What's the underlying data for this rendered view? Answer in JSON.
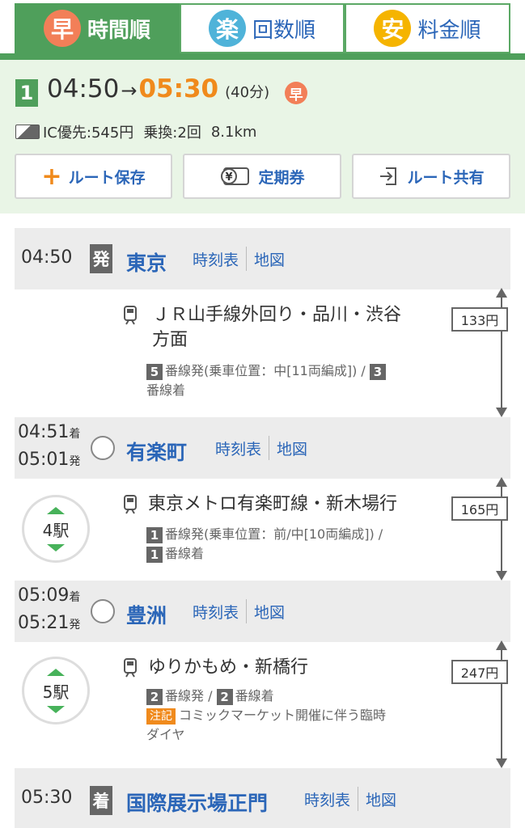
{
  "tabs": [
    {
      "badge": "早",
      "label": "時間順",
      "color": "#f27f58",
      "active": true
    },
    {
      "badge": "楽",
      "label": "回数順",
      "color": "#4fb3d9",
      "active": false
    },
    {
      "badge": "安",
      "label": "料金順",
      "color": "#f5b400",
      "active": false
    }
  ],
  "summary": {
    "route_no": "1",
    "depart": "04:50",
    "arrow": "→",
    "arrive": "05:30",
    "duration": "(40分)",
    "fast_badge": "早",
    "ic_fare": "IC優先:545円",
    "transfers": "乗換:2回",
    "distance": "8.1km",
    "buttons": {
      "save": "ルート保存",
      "pass": "定期券",
      "share": "ルート共有",
      "yen": "¥"
    }
  },
  "links": {
    "timetable": "時刻表",
    "map": "地図"
  },
  "stations": [
    {
      "name": "東京",
      "time1": "04:50",
      "badge": "発"
    },
    {
      "name": "有楽町",
      "time1": "04:51",
      "suffix1": "着",
      "time2": "05:01",
      "suffix2": "発"
    },
    {
      "name": "豊洲",
      "time1": "05:09",
      "suffix1": "着",
      "time2": "05:21",
      "suffix2": "発"
    },
    {
      "name": "国際展示場正門",
      "time1": "05:30",
      "badge": "着"
    }
  ],
  "segments": [
    {
      "line1": "ＪＲ山手線外回り・品川・渋谷",
      "line2": "方面",
      "plat_a_num": "5",
      "plat_a": "番線発(乗車位置：中[11両編成]) / ",
      "plat_b_num": "3",
      "plat_b": "番線着",
      "fare": "133円",
      "color": "#3fdc3a"
    },
    {
      "line1": "東京メトロ有楽町線・新木場行",
      "plat_a_num": "1",
      "plat_a": "番線発(乗車位置：前/中[10両編成]) /",
      "plat_b_num": "1",
      "plat_b": "番線着",
      "fare": "165円",
      "stops": "4駅",
      "color": "#c1a470"
    },
    {
      "line1": "ゆりかもめ・新橋行",
      "plat_a_num": "2",
      "plat_a": "番線発 / ",
      "plat_b_num": "2",
      "plat_b": "番線着",
      "note_label": "注記",
      "note1": "コミックマーケット開催に伴う臨時",
      "note2": "ダイヤ",
      "fare": "247円",
      "stops": "5駅",
      "color": "#1b84cf"
    }
  ]
}
